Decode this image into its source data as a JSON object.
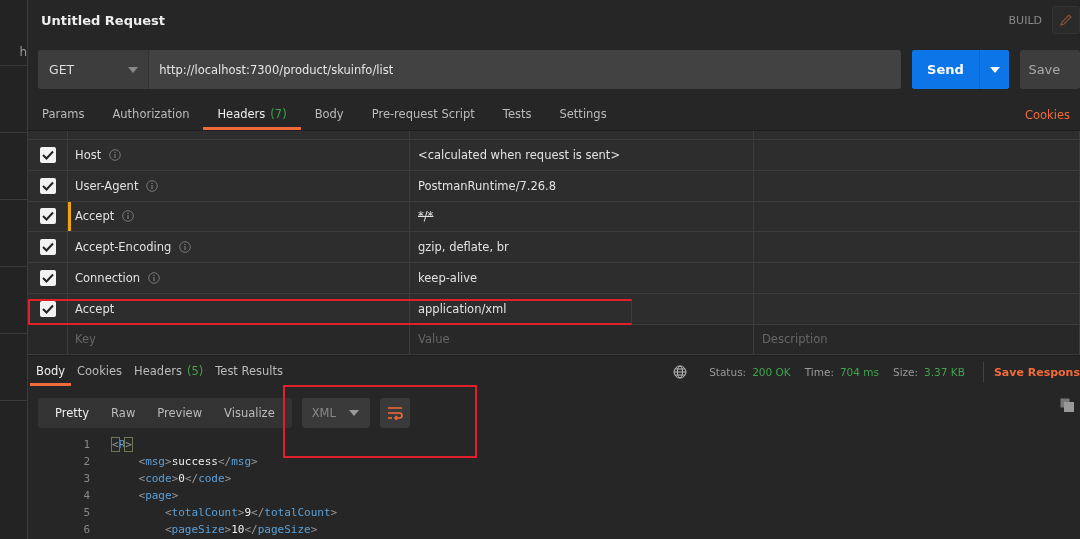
{
  "sidebar": {
    "items": [
      {
        "label": "h"
      }
    ]
  },
  "request": {
    "title": "Untitled Request",
    "mode": "BUILD",
    "method": "GET",
    "url": "http://localhost:7300/product/skuinfo/list",
    "send": "Send",
    "save": "Save"
  },
  "request_tabs": [
    {
      "label": "Params",
      "selected": false
    },
    {
      "label": "Authorization",
      "selected": false
    },
    {
      "label": "Headers",
      "count": "(7)",
      "selected": true
    },
    {
      "label": "Body",
      "selected": false
    },
    {
      "label": "Pre-request Script",
      "selected": false
    },
    {
      "label": "Tests",
      "selected": false
    },
    {
      "label": "Settings",
      "selected": false
    }
  ],
  "cookies_link": "Cookies",
  "headers": {
    "rows": [
      {
        "key": "Host",
        "info": true,
        "value": "<calculated when request is sent>",
        "checked": true,
        "overridden": false,
        "highlighted": false
      },
      {
        "key": "User-Agent",
        "info": true,
        "value": "PostmanRuntime/7.26.8",
        "checked": true,
        "overridden": false,
        "highlighted": false
      },
      {
        "key": "Accept",
        "info": true,
        "value": "*/*",
        "checked": true,
        "overridden": true,
        "highlighted": false
      },
      {
        "key": "Accept-Encoding",
        "info": true,
        "value": "gzip, deflate, br",
        "checked": true,
        "overridden": false,
        "highlighted": false
      },
      {
        "key": "Connection",
        "info": true,
        "value": "keep-alive",
        "checked": true,
        "overridden": false,
        "highlighted": false
      },
      {
        "key": "Accept",
        "info": false,
        "value": "application/xml",
        "checked": true,
        "overridden": false,
        "highlighted": true
      }
    ],
    "placeholder_key": "Key",
    "placeholder_value": "Value",
    "placeholder_description": "Description"
  },
  "response": {
    "tabs": [
      {
        "label": "Body",
        "selected": true
      },
      {
        "label": "Cookies",
        "selected": false
      },
      {
        "label": "Headers",
        "count": "(5)",
        "selected": false
      },
      {
        "label": "Test Results",
        "selected": false
      }
    ],
    "status_label": "Status:",
    "status": "200 OK",
    "time_label": "Time:",
    "time": "704 ms",
    "size_label": "Size:",
    "size": "3.37 KB",
    "save_response": "Save Respons",
    "views": [
      {
        "label": "Pretty",
        "selected": true
      },
      {
        "label": "Raw",
        "selected": false
      },
      {
        "label": "Preview",
        "selected": false
      },
      {
        "label": "Visualize",
        "selected": false
      }
    ],
    "format": "XML",
    "wrap_on": true,
    "toolbar_highlighted": true,
    "code": [
      {
        "number": "1",
        "tokens": [
          {
            "kind": "match",
            "text": "<"
          },
          {
            "kind": "tag",
            "text": "R"
          },
          {
            "kind": "match",
            "text": ">"
          }
        ]
      },
      {
        "number": "2",
        "tokens": [
          {
            "kind": "punct",
            "text": "    <"
          },
          {
            "kind": "tag",
            "text": "msg"
          },
          {
            "kind": "punct",
            "text": ">"
          },
          {
            "kind": "text",
            "text": "success"
          },
          {
            "kind": "punct",
            "text": "</"
          },
          {
            "kind": "tag",
            "text": "msg"
          },
          {
            "kind": "punct",
            "text": ">"
          }
        ]
      },
      {
        "number": "3",
        "tokens": [
          {
            "kind": "punct",
            "text": "    <"
          },
          {
            "kind": "tag",
            "text": "code"
          },
          {
            "kind": "punct",
            "text": ">"
          },
          {
            "kind": "text",
            "text": "0"
          },
          {
            "kind": "punct",
            "text": "</"
          },
          {
            "kind": "tag",
            "text": "code"
          },
          {
            "kind": "punct",
            "text": ">"
          }
        ]
      },
      {
        "number": "4",
        "tokens": [
          {
            "kind": "punct",
            "text": "    <"
          },
          {
            "kind": "tag",
            "text": "page"
          },
          {
            "kind": "punct",
            "text": ">"
          }
        ]
      },
      {
        "number": "5",
        "tokens": [
          {
            "kind": "punct",
            "text": "        <"
          },
          {
            "kind": "tag",
            "text": "totalCount"
          },
          {
            "kind": "punct",
            "text": ">"
          },
          {
            "kind": "text",
            "text": "9"
          },
          {
            "kind": "punct",
            "text": "</"
          },
          {
            "kind": "tag",
            "text": "totalCount"
          },
          {
            "kind": "punct",
            "text": ">"
          }
        ]
      },
      {
        "number": "6",
        "tokens": [
          {
            "kind": "punct",
            "text": "        <"
          },
          {
            "kind": "tag",
            "text": "pageSize"
          },
          {
            "kind": "punct",
            "text": ">"
          },
          {
            "kind": "text",
            "text": "10"
          },
          {
            "kind": "punct",
            "text": "</"
          },
          {
            "kind": "tag",
            "text": "pageSize"
          },
          {
            "kind": "punct",
            "text": ">"
          }
        ]
      }
    ]
  }
}
